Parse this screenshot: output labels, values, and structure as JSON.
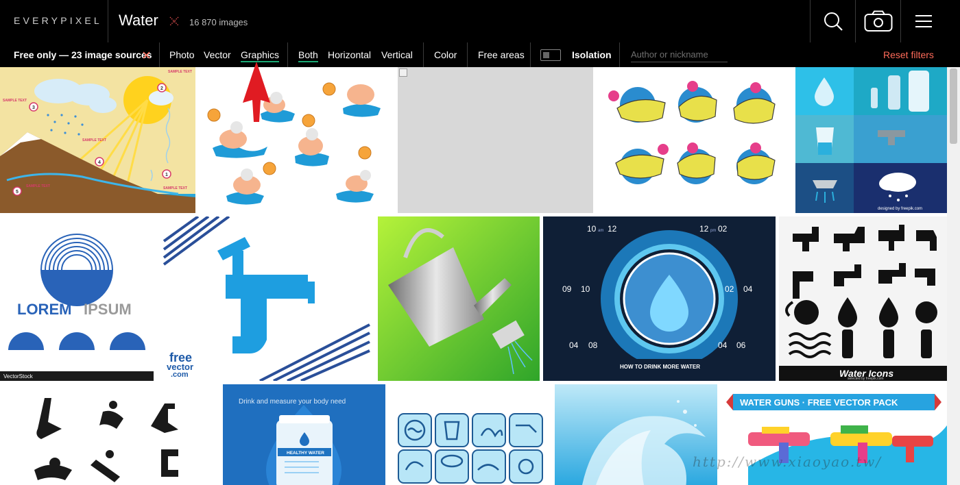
{
  "header": {
    "logo": "EVERYPIXEL",
    "query": "Water",
    "count": "16 870 images",
    "icons": [
      "search-icon",
      "camera-icon",
      "menu-icon"
    ]
  },
  "filters": {
    "source_label": "Free only — 23 image sources",
    "types": [
      "Photo",
      "Vector",
      "Graphics"
    ],
    "active_type": "Graphics",
    "orientations": [
      "Both",
      "Horizontal",
      "Vertical"
    ],
    "active_orientation": "Both",
    "color_label": "Color",
    "free_areas_label": "Free areas",
    "isolation_label": "Isolation",
    "author_placeholder": "Author or nickname",
    "reset_label": "Reset filters"
  },
  "tiles": {
    "infographic_labels": [
      "SAMPLE TEXT",
      "SAMPLE TEXT",
      "SAMPLE TEXT",
      "SAMPLE TEXT",
      "SAMPLE TEXT"
    ],
    "infographic_numbers": [
      "1",
      "2",
      "3",
      "4",
      "5"
    ],
    "logo_main": "LOREM",
    "logo_sub": "IPSUM",
    "vectorstock": "VectorStock",
    "freevector_line1": "free",
    "freevector_line2": "vector",
    "freevector_line3": ".com",
    "designed_by": "designed by freepik.com",
    "clock": {
      "t1": "10",
      "t1b": "12",
      "t2": "12",
      "t2b": "02",
      "t3": "09",
      "t3b": "10",
      "t4": "02",
      "t4b": "04",
      "t5": "04",
      "t5b": "08",
      "t6": "04",
      "t6b": "06",
      "am": "am",
      "pm": "pm",
      "title": "HOW TO DRINK MORE WATER"
    },
    "faucet_caption": "Water Icons",
    "faucet_credit": "selected by freepik.com",
    "drink_title": "Drink and measure your body need",
    "healthy": "HEALTHY WATER",
    "guns_title": "WATER GUNS · FREE VECTOR PACK",
    "watermark": "http://www.xiaoyao.tw/"
  },
  "colors": {
    "accent_green": "#19a974",
    "reset_red": "#ff6b5a",
    "header_bg": "#000000"
  }
}
